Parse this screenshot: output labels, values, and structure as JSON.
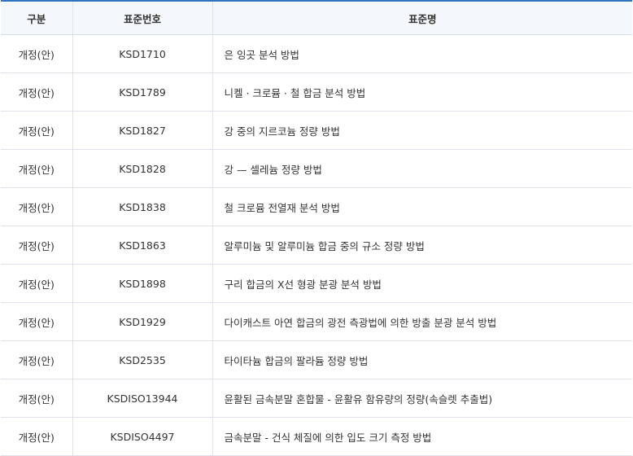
{
  "table": {
    "headers": {
      "type": "구분",
      "code": "표준번호",
      "name": "표준명"
    },
    "rows": [
      {
        "type": "개정(안)",
        "code": "KSD1710",
        "name": "은 잉곳 분석 방법"
      },
      {
        "type": "개정(안)",
        "code": "KSD1789",
        "name": "니켈 · 크로뮴 · 철 합금 분석 방법"
      },
      {
        "type": "개정(안)",
        "code": "KSD1827",
        "name": "강 중의 지르코늄 정량 방법"
      },
      {
        "type": "개정(안)",
        "code": "KSD1828",
        "name": "강 — 셀레늄 정량 방법"
      },
      {
        "type": "개정(안)",
        "code": "KSD1838",
        "name": "철 크로뮴 전열재 분석 방법"
      },
      {
        "type": "개정(안)",
        "code": "KSD1863",
        "name": "알루미늄 및 알루미늄 합금 중의 규소 정량 방법"
      },
      {
        "type": "개정(안)",
        "code": "KSD1898",
        "name": "구리 합금의 X선 형광 분광 분석 방법"
      },
      {
        "type": "개정(안)",
        "code": "KSD1929",
        "name": "다이캐스트 아연 합금의 광전 측광법에 의한 방출 분광 분석 방법"
      },
      {
        "type": "개정(안)",
        "code": "KSD2535",
        "name": "타이타늄 합금의 팔라듐 정량 방법"
      },
      {
        "type": "개정(안)",
        "code": "KSDISO13944",
        "name": "윤활된 금속분말 혼합물 - 윤활유 함유량의 정량(속슬렛 추출법)"
      },
      {
        "type": "개정(안)",
        "code": "KSDISO4497",
        "name": "금속분말 - 건식 체질에 의한 입도 크기 측정 방법"
      }
    ]
  }
}
